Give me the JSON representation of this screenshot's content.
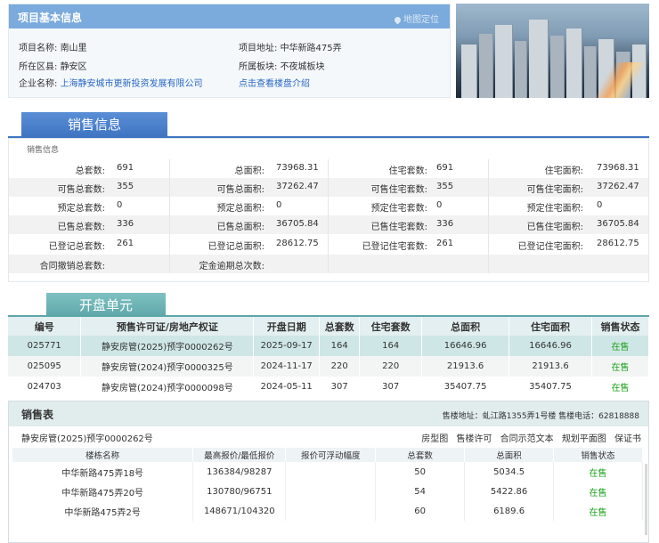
{
  "basic": {
    "title": "项目基本信息",
    "map_link": "地图定位",
    "project_name_label": "项目名称:",
    "project_name": "南山里",
    "district_label": "所在区县:",
    "district": "静安区",
    "company_label": "企业名称:",
    "company": "上海静安城市更新投资发展有限公司",
    "address_label": "项目地址:",
    "address": "中华新路475弄",
    "block_label": "所属板块:",
    "block": "不夜城板块",
    "intro_link": "点击查看楼盘介绍"
  },
  "sales_info": {
    "tab": "销售信息",
    "sub": "销售信息",
    "rows": [
      [
        [
          "总套数:",
          "691"
        ],
        [
          "总面积:",
          "73968.31"
        ],
        [
          "住宅套数:",
          "691"
        ],
        [
          "住宅面积:",
          "73968.31"
        ]
      ],
      [
        [
          "可售总套数:",
          "355"
        ],
        [
          "可售总面积:",
          "37262.47"
        ],
        [
          "可售住宅套数:",
          "355"
        ],
        [
          "可售住宅面积:",
          "37262.47"
        ]
      ],
      [
        [
          "预定总套数:",
          "0"
        ],
        [
          "预定总面积:",
          "0"
        ],
        [
          "预定住宅套数:",
          "0"
        ],
        [
          "预定住宅面积:",
          "0"
        ]
      ],
      [
        [
          "已售总套数:",
          "336"
        ],
        [
          "已售总面积:",
          "36705.84"
        ],
        [
          "已售住宅套数:",
          "336"
        ],
        [
          "已售住宅面积:",
          "36705.84"
        ]
      ],
      [
        [
          "已登记总套数:",
          "261"
        ],
        [
          "已登记总面积:",
          "28612.75"
        ],
        [
          "已登记住宅套数:",
          "261"
        ],
        [
          "已登记住宅面积:",
          "28612.75"
        ]
      ],
      [
        [
          "合同撤销总套数:",
          ""
        ],
        [
          "定金逾期总次数:",
          ""
        ],
        [
          "",
          ""
        ],
        [
          "",
          ""
        ]
      ]
    ]
  },
  "open_units": {
    "tab": "开盘单元",
    "headers": [
      "编号",
      "预售许可证/房地产权证",
      "开盘日期",
      "总套数",
      "住宅套数",
      "总面积",
      "住宅面积",
      "销售状态"
    ],
    "rows": [
      [
        "025771",
        "静安房管(2025)预字0000262号",
        "2025-09-17",
        "164",
        "164",
        "16646.96",
        "16646.96",
        "在售"
      ],
      [
        "025095",
        "静安房管(2024)预字0000325号",
        "2024-11-17",
        "220",
        "220",
        "21913.6",
        "21913.6",
        "在售"
      ],
      [
        "024703",
        "静安房管(2024)预字0000098号",
        "2024-05-11",
        "307",
        "307",
        "35407.75",
        "35407.75",
        "在售"
      ]
    ]
  },
  "sales_table": {
    "title": "销售表",
    "address_line": "售楼地址：虬江路1355弄1号楼 售楼电话：62818888",
    "permit": "静安房管(2025)预字0000262号",
    "links": [
      "房型图",
      "售楼许可",
      "合同示范文本",
      "规划平面图",
      "保证书"
    ],
    "headers": [
      "楼栋名称",
      "最高报价/最低报价",
      "报价可浮动幅度",
      "总套数",
      "总面积",
      "销售状态"
    ],
    "rows": [
      [
        "中华新路475弄18号",
        "136384/98287",
        "",
        "50",
        "5034.5",
        "在售"
      ],
      [
        "中华新路475弄20号",
        "130780/96751",
        "",
        "54",
        "5422.86",
        "在售"
      ],
      [
        "中华新路475弄2号",
        "148671/104320",
        "",
        "60",
        "6189.6",
        "在售"
      ]
    ]
  },
  "colors": {
    "header_blue": "#7baadc",
    "tab_blue": "#3f74c2",
    "tab_teal": "#5da6a8",
    "status_green": "#1ea21e",
    "link_blue": "#2867c5"
  }
}
